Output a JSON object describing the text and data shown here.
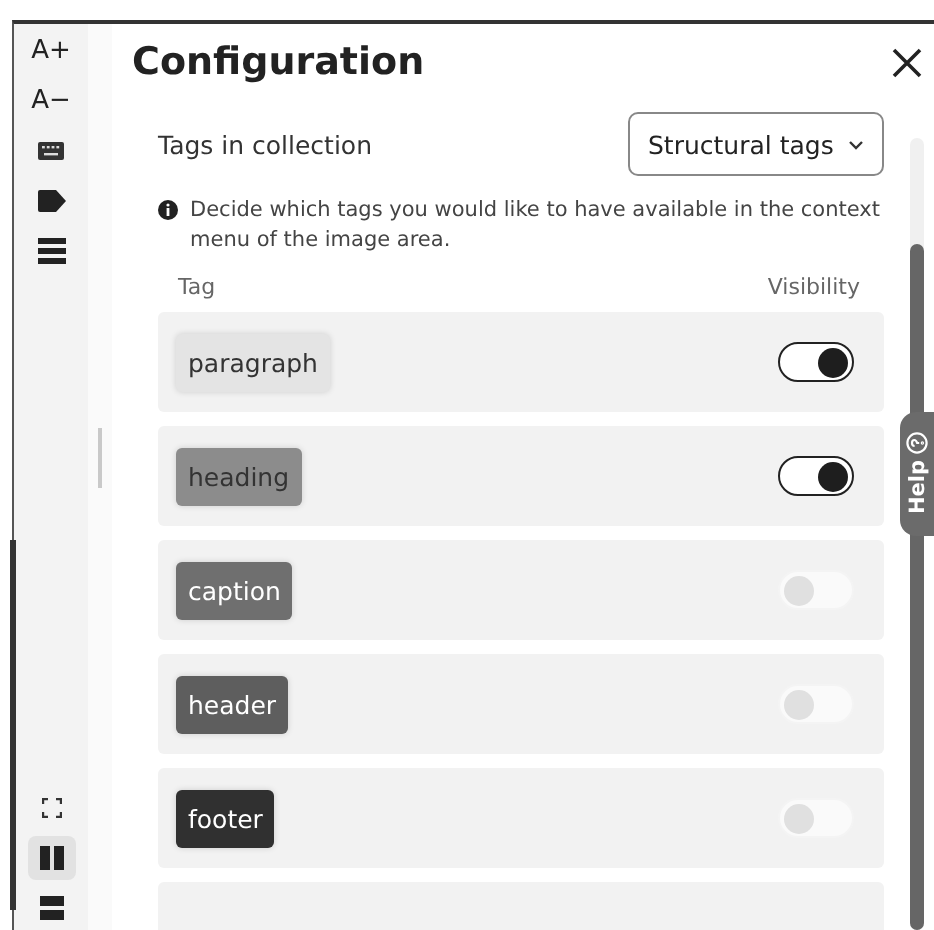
{
  "toolbar": [
    {
      "kind": "text",
      "label": "A+"
    },
    {
      "kind": "text",
      "label": "A−"
    },
    {
      "kind": "keyboard"
    },
    {
      "kind": "tag"
    },
    {
      "kind": "list"
    }
  ],
  "view_buttons": [
    {
      "kind": "fullscreen",
      "selected": false
    },
    {
      "kind": "columns",
      "selected": true
    },
    {
      "kind": "rows",
      "selected": false
    }
  ],
  "dialog": {
    "title": "Configuration",
    "collection_label": "Tags in collection",
    "collection_select": "Structural tags",
    "info": "Decide which tags you would like to have available in the context menu of the image area.",
    "columns": [
      "Tag",
      "Visibility"
    ],
    "tags": [
      {
        "name": "paragraph",
        "color": "#e4e4e4",
        "on": true
      },
      {
        "name": "heading",
        "color": "#8c8c8c",
        "on": true
      },
      {
        "name": "caption",
        "color": "#6f6f6f",
        "on": false
      },
      {
        "name": "header",
        "color": "#5e5e5e",
        "on": false
      },
      {
        "name": "footer",
        "color": "#303030",
        "on": false
      }
    ]
  },
  "help": "Help"
}
